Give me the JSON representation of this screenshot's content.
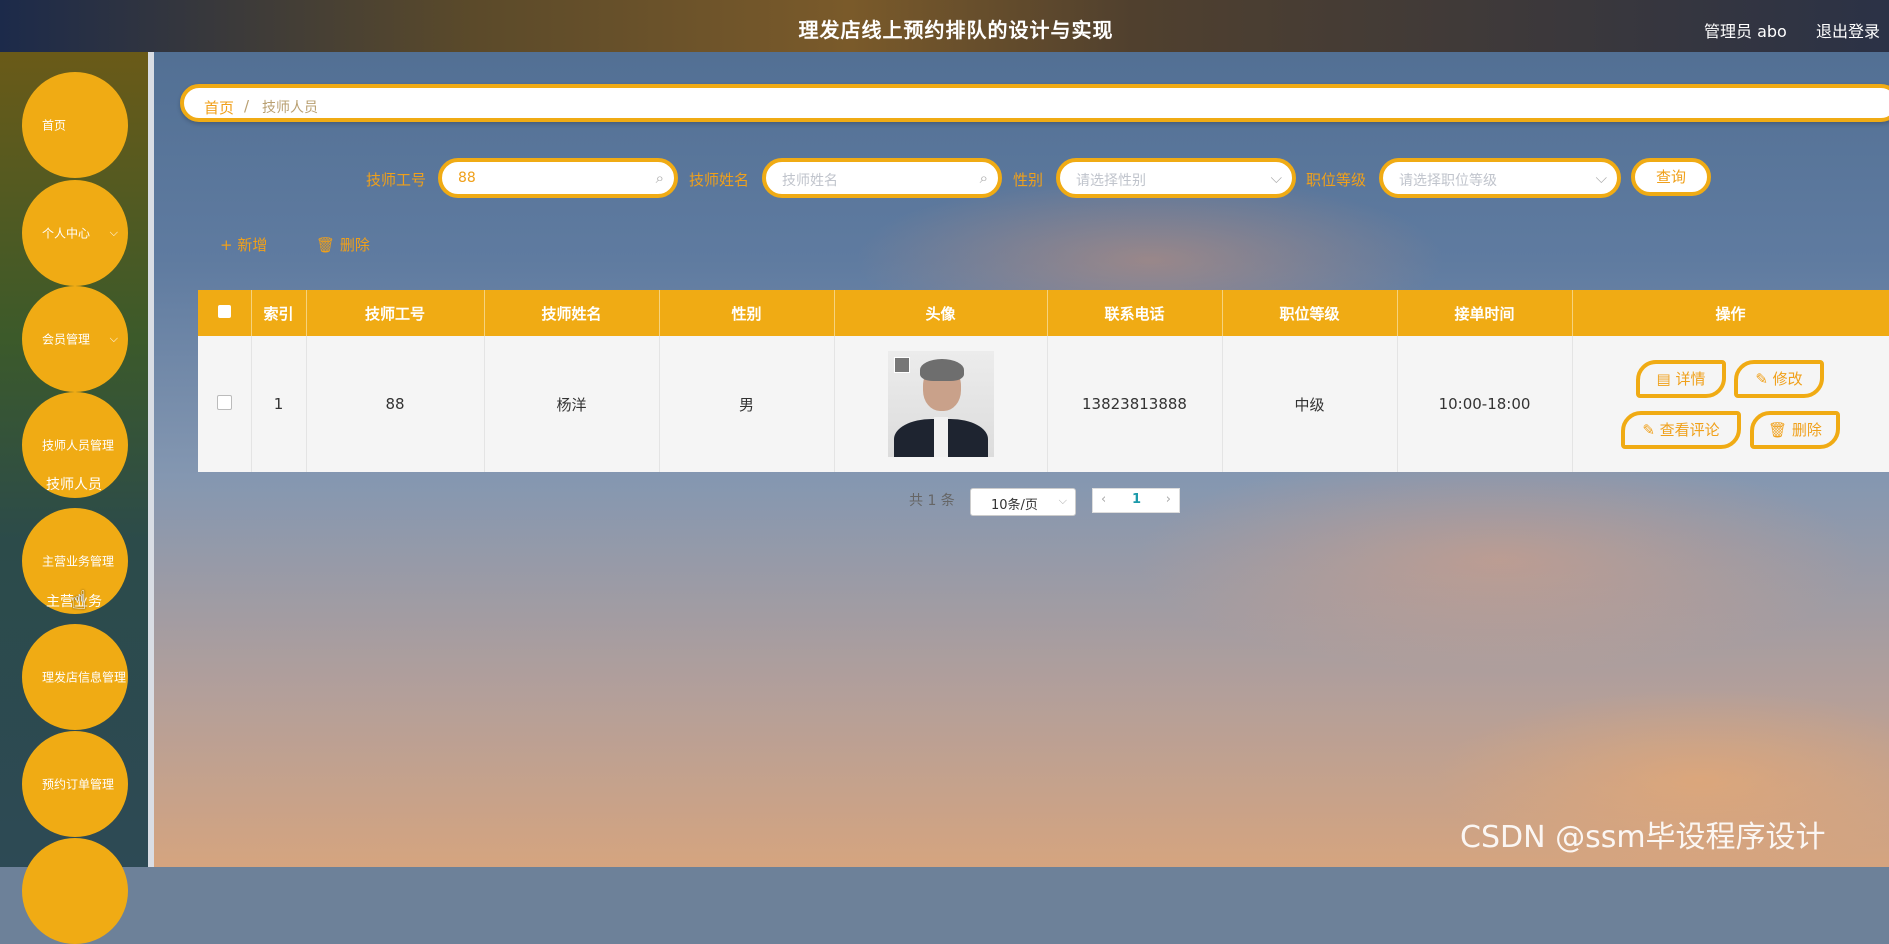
{
  "header": {
    "title": "理发店线上预约排队的设计与实现",
    "admin": "管理员 abo",
    "logout": "退出登录"
  },
  "sidebar": {
    "items": [
      {
        "label": "首页",
        "chevron": false
      },
      {
        "label": "个人中心",
        "chevron": true
      },
      {
        "label": "会员管理",
        "chevron": true
      },
      {
        "label": "技师人员管理",
        "chevron": false
      },
      {
        "label": "主营业务管理",
        "chevron": false
      },
      {
        "label": "理发店信息管理",
        "chevron": false
      },
      {
        "label": "预约订单管理",
        "chevron": false
      }
    ],
    "sub_technician": "技师人员",
    "sub_business": "主营业务"
  },
  "breadcrumb": {
    "home": "首页",
    "separator": "/",
    "current": "技师人员"
  },
  "search": {
    "tech_id_label": "技师工号",
    "tech_id_value": "88",
    "tech_name_label": "技师姓名",
    "tech_name_placeholder": "技师姓名",
    "gender_label": "性别",
    "gender_placeholder": "请选择性别",
    "level_label": "职位等级",
    "level_placeholder": "请选择职位等级",
    "query_button": "查询"
  },
  "actions": {
    "add": "新增",
    "delete": "删除"
  },
  "table": {
    "headers": [
      "",
      "索引",
      "技师工号",
      "技师姓名",
      "性别",
      "头像",
      "联系电话",
      "职位等级",
      "接单时间",
      "操作"
    ],
    "rows": [
      {
        "index": "1",
        "tech_id": "88",
        "name": "杨洋",
        "gender": "男",
        "phone": "13823813888",
        "level": "中级",
        "hours": "10:00-18:00"
      }
    ],
    "ops": {
      "detail": "详情",
      "edit": "修改",
      "comments": "查看评论",
      "delete": "删除"
    }
  },
  "pagination": {
    "total": "共 1 条",
    "page_size": "10条/页",
    "current_page": "1"
  },
  "watermark": "CSDN @ssm毕设程序设计",
  "colors": {
    "accent": "#f0ab14",
    "accent_text": "#f0a01a"
  },
  "icons": {
    "search": "search-icon",
    "chevron": "chevron-down-icon",
    "add": "plus-icon",
    "delete": "trash-icon",
    "detail": "document-icon",
    "edit": "pencil-icon"
  }
}
